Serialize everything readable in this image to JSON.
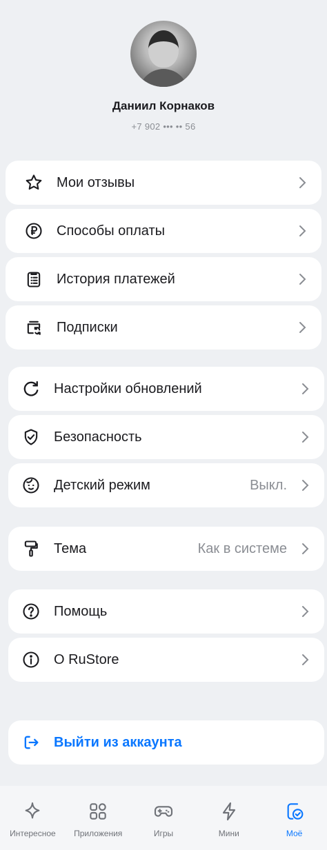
{
  "profile": {
    "name": "Даниил Корнаков",
    "phone": "+7 902 ••• •• 56"
  },
  "menu": {
    "reviews": "Мои отзывы",
    "payment_methods": "Способы оплаты",
    "payment_history": "История платежей",
    "subscriptions": "Подписки",
    "update_settings": "Настройки обновлений",
    "security": "Безопасность",
    "kids_mode": "Детский режим",
    "kids_mode_value": "Выкл.",
    "theme": "Тема",
    "theme_value": "Как в системе",
    "help": "Помощь",
    "about": "О RuStore",
    "logout": "Выйти из аккаунта"
  },
  "tabs": {
    "interesting": "Интересное",
    "apps": "Приложения",
    "games": "Игры",
    "mini": "Мини",
    "mine": "Моё"
  },
  "colors": {
    "accent": "#0a77ff",
    "background": "#eef0f3",
    "card": "#ffffff",
    "secondary_text": "#8a8d93"
  }
}
